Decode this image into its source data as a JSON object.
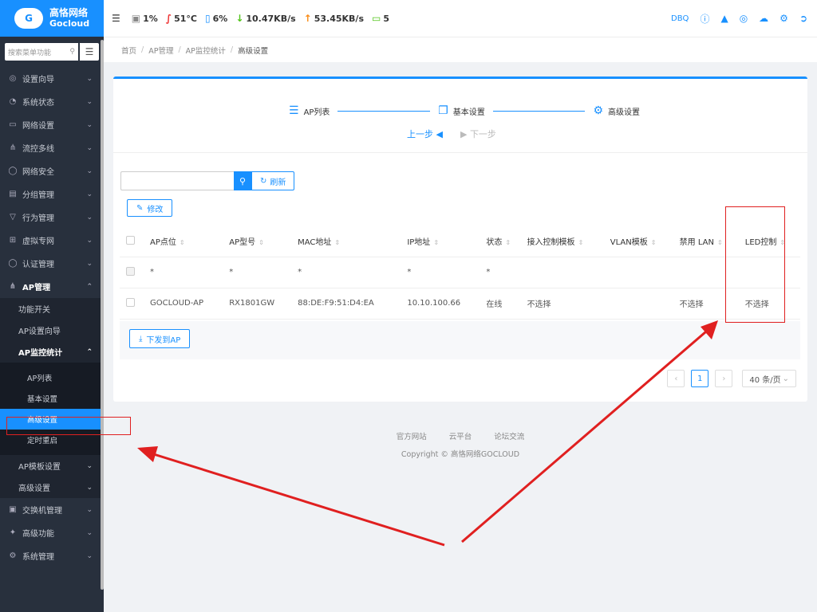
{
  "brand": {
    "cn": "高恪网络",
    "en": "Gocloud",
    "logo_text": "G"
  },
  "sidebar": {
    "search_placeholder": "搜索菜单功能",
    "items": [
      {
        "label": "设置向导",
        "icon": "compass-icon"
      },
      {
        "label": "系统状态",
        "icon": "dashboard-icon"
      },
      {
        "label": "网络设置",
        "icon": "monitor-icon"
      },
      {
        "label": "流控多线",
        "icon": "network-icon"
      },
      {
        "label": "网络安全",
        "icon": "shield-icon"
      },
      {
        "label": "分组管理",
        "icon": "list-icon"
      },
      {
        "label": "行为管理",
        "icon": "filter-icon"
      },
      {
        "label": "虚拟专网",
        "icon": "vpn-icon"
      },
      {
        "label": "认证管理",
        "icon": "check-shield-icon"
      },
      {
        "label": "AP管理",
        "icon": "sitemap-icon"
      }
    ],
    "ap_sub": [
      "功能开关",
      "AP设置向导",
      "AP监控统计"
    ],
    "ap_monitor_sub": [
      "AP列表",
      "基本设置",
      "高级设置",
      "定时重启"
    ],
    "ap_sub_after": [
      "AP模板设置",
      "高级设置"
    ],
    "items_after": [
      {
        "label": "交换机管理",
        "icon": "switch-icon"
      },
      {
        "label": "高级功能",
        "icon": "pin-icon"
      },
      {
        "label": "系统管理",
        "icon": "gear-icon"
      }
    ]
  },
  "topbar": {
    "cpu": "1%",
    "temp": "51°C",
    "mem": "6%",
    "down": "10.47KB/s",
    "up": "53.45KB/s",
    "terminals": "5",
    "user": "DBQ"
  },
  "breadcrumb": [
    "首页",
    "AP管理",
    "AP监控统计",
    "高级设置"
  ],
  "steps": [
    {
      "label": "AP列表",
      "icon": "list-icon"
    },
    {
      "label": "基本设置",
      "icon": "copy-icon"
    },
    {
      "label": "高级设置",
      "icon": "gear-icon"
    }
  ],
  "step_nav": {
    "prev": "上一步",
    "next": "下一步"
  },
  "toolbar": {
    "refresh": "刷新",
    "edit": "修改",
    "deliver": "下发到AP"
  },
  "table": {
    "headers": [
      "AP点位",
      "AP型号",
      "MAC地址",
      "IP地址",
      "状态",
      "接入控制模板",
      "VLAN模板",
      "禁用 LAN",
      "LED控制"
    ],
    "placeholder_row": [
      "*",
      "*",
      "*",
      "*",
      "*",
      "",
      "",
      "",
      ""
    ],
    "rows": [
      [
        "GOCLOUD-AP",
        "RX1801GW",
        "88:DE:F9:51:D4:EA",
        "10.10.100.66",
        "在线",
        "不选择",
        "",
        "不选择",
        "不选择"
      ]
    ]
  },
  "pager": {
    "current": "1",
    "size": "40 条/页"
  },
  "footer": {
    "links": [
      "官方网站",
      "云平台",
      "论坛交流"
    ],
    "copyright": "Copyright © 高恪网络GOCLOUD"
  }
}
